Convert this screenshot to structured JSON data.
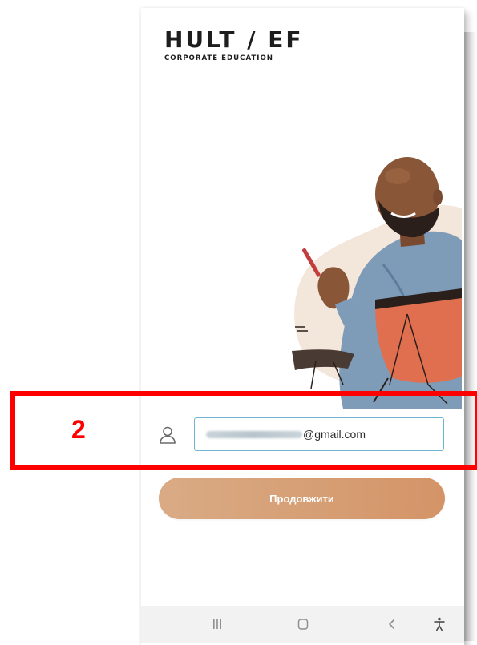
{
  "app": {
    "logo_title": "HULT / EF",
    "logo_subtitle": "CORPORATE EDUCATION"
  },
  "login": {
    "email_visible_domain": "@gmail.com",
    "email_local_part_blurred": true,
    "continue_label": "Продовжити"
  },
  "annotation": {
    "step_number": "2",
    "highlight_color": "#ff0000"
  },
  "colors": {
    "button_gradient_start": "#d9ab85",
    "button_gradient_end": "#d49467",
    "input_border": "#6fb6d2",
    "text_dark": "#1d1d1d"
  },
  "icons": {
    "user": "user-icon",
    "recents": "recents-icon",
    "home": "home-icon",
    "back": "back-icon",
    "accessibility": "accessibility-icon"
  }
}
